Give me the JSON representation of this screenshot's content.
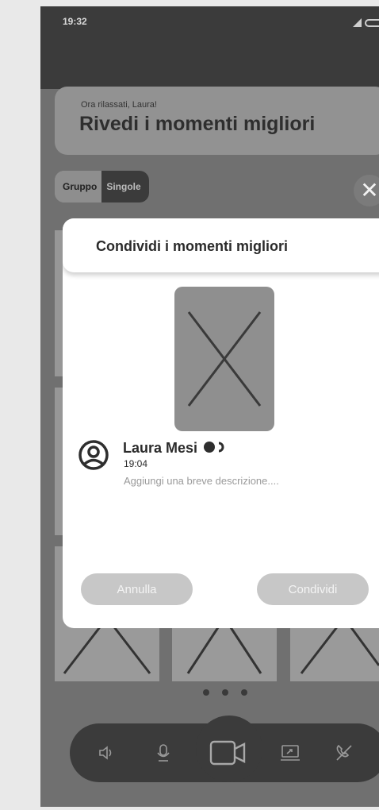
{
  "status": {
    "time": "19:32"
  },
  "header": {
    "subtitle": "Ora rilassati, Laura!",
    "title": "Rivedi i momenti migliori"
  },
  "segments": {
    "group_label": "Gruppo",
    "single_label": "Singole"
  },
  "modal": {
    "title": "Condividi i momenti migliori",
    "user_name": "Laura Mesi",
    "time": "19:04",
    "description_placeholder": "Aggiungi una breve descrizione....",
    "cancel_label": "Annulla",
    "share_label": "Condividi"
  },
  "controls": [
    "speaker-icon",
    "microphone-icon",
    "video-camera-icon",
    "screen-share-icon",
    "end-call-icon"
  ],
  "colors": {
    "background": "#707070",
    "dark": "#3b3b3b",
    "modal": "#ffffff",
    "button": "#c7c7c7"
  }
}
